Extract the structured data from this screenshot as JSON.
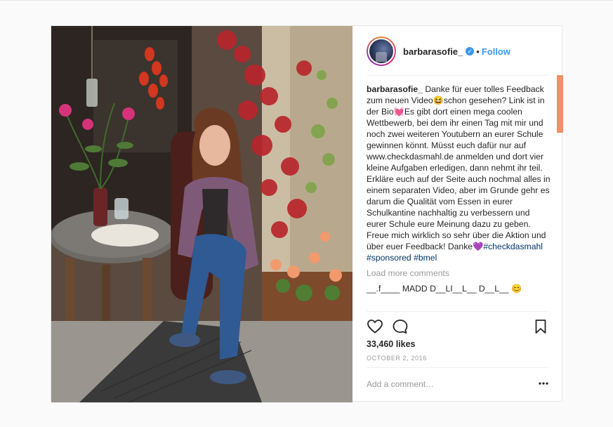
{
  "post": {
    "username": "barbarasofie_",
    "verified_icon": "verified-check-icon",
    "separator": "•",
    "follow_label": "Follow",
    "caption": {
      "author": "barbarasofie_",
      "part1": "Danke für euer tolles Feedback zum neuen Video",
      "emoji1": "😆",
      "part2": "schon gesehen? Link ist in der Bio",
      "emoji2": "💓",
      "part3": "Es gibt dort einen mega coolen Wettbewerb, bei dem ihr einen Tag mit mir und noch zwei weiteren Youtubern an eurer Schule gewinnen könnt. Müsst euch dafür nur auf www.checkdasmahl.de anmelden und dort vier kleine Aufgaben erledigen, dann nehmt ihr teil. Erkläre euch auf der Seite auch nochmal alles in einem separaten Video, aber im Grunde gehr es darum die Qualität vom Essen in eurer Schulkantine nachhaltig zu verbessern und eurer Schule eure Meinung dazu zu geben. Freue mich wirklich so sehr über die Aktion und über euer Feedback! Danke",
      "emoji3": "💜",
      "hashtag1": "#checkdasmahl",
      "hashtag2": "#sponsored",
      "hashtag3": "#bmel"
    },
    "load_more_label": "Load more comments",
    "partial_comment": "__.f____ MADD D__LI__L__ D__L__ 😊",
    "likes": "33,460 likes",
    "date": "OCTOBER 2, 2016",
    "add_comment_placeholder": "Add a comment…",
    "icons": [
      "heart-icon",
      "comment-icon",
      "bookmark-icon",
      "more-options-icon"
    ],
    "colors": {
      "follow": "#3897f0",
      "hashtag": "#003569",
      "scrollbar": "#f0906a"
    }
  }
}
